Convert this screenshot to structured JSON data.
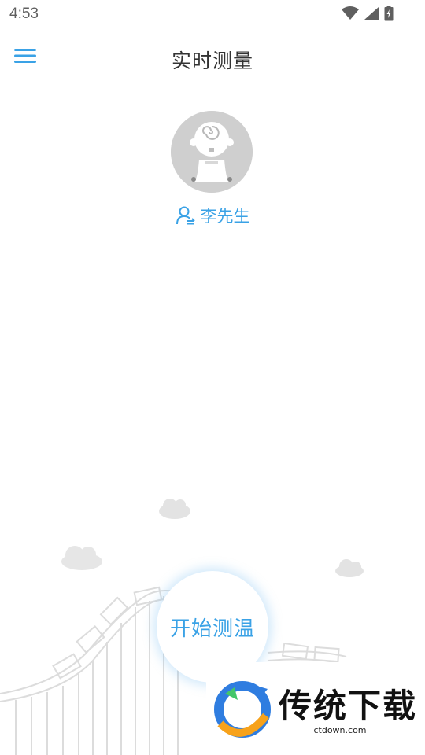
{
  "status_bar": {
    "time": "4:53"
  },
  "app_bar": {
    "title": "实时测量"
  },
  "user": {
    "name": "李先生"
  },
  "action": {
    "start_label": "开始测温"
  },
  "watermark": {
    "brand": "传统下载",
    "url": "ctdown.com"
  },
  "colors": {
    "accent": "#3aa2e6",
    "title": "#333333",
    "avatar_bg": "#cfcfcf"
  }
}
